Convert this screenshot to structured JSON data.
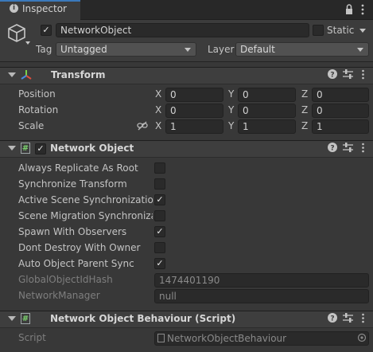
{
  "tab": {
    "title": "Inspector",
    "icon": "info-icon"
  },
  "window_buttons": {
    "lock": "lock-icon",
    "menu": "kebab-menu-icon"
  },
  "header": {
    "object_name": "NetworkObject",
    "active": true,
    "static_label": "Static",
    "static": false,
    "tag_label": "Tag",
    "tag_value": "Untagged",
    "layer_label": "Layer",
    "layer_value": "Default"
  },
  "transform": {
    "title": "Transform",
    "position_label": "Position",
    "rotation_label": "Rotation",
    "scale_label": "Scale",
    "x": "X",
    "y": "Y",
    "z": "Z",
    "position": [
      "0",
      "0",
      "0"
    ],
    "rotation": [
      "0",
      "0",
      "0"
    ],
    "scale": [
      "1",
      "1",
      "1"
    ]
  },
  "network_object": {
    "title": "Network Object",
    "enabled": true,
    "fields": [
      {
        "label": "Always Replicate As Root",
        "checked": false
      },
      {
        "label": "Synchronize Transform",
        "checked": false
      },
      {
        "label": "Active Scene Synchronization",
        "checked": true
      },
      {
        "label": "Scene Migration Synchronizat",
        "checked": false
      },
      {
        "label": "Spawn With Observers",
        "checked": true
      },
      {
        "label": "Dont Destroy With Owner",
        "checked": false
      },
      {
        "label": "Auto Object Parent Sync",
        "checked": true
      }
    ],
    "hash_label": "GlobalObjectIdHash",
    "hash_value": "1474401190",
    "manager_label": "NetworkManager",
    "manager_value": "null"
  },
  "behaviour": {
    "title": "Network Object Behaviour (Script)",
    "script_label": "Script",
    "script_value": "NetworkObjectBehaviour"
  },
  "check_glyph": "✓"
}
